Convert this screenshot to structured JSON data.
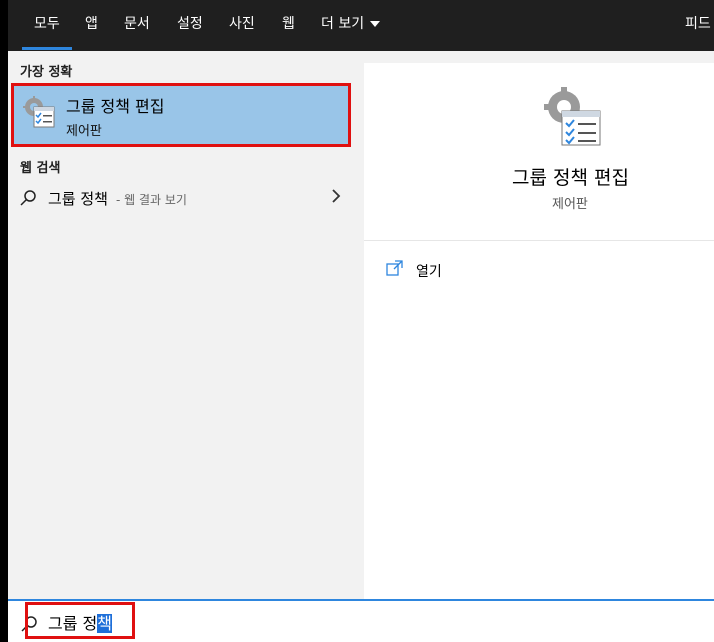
{
  "tabs": [
    {
      "label": "모두",
      "active": true
    },
    {
      "label": "앱"
    },
    {
      "label": "문서"
    },
    {
      "label": "설정"
    },
    {
      "label": "사진"
    },
    {
      "label": "웹"
    },
    {
      "label": "더 보기"
    },
    {
      "label": "피드"
    }
  ],
  "left": {
    "best_match_heading": "가장 정확",
    "best_match": {
      "title": "그룹 정책 편집",
      "subtitle": "제어판",
      "icon": "group-policy-icon"
    },
    "web_heading": "웹 검색",
    "web_result": {
      "query": "그룹 정책",
      "hint": "- 웹 결과 보기"
    }
  },
  "right": {
    "app_title": "그룹 정책 편집",
    "app_subtitle": "제어판",
    "action_open": "열기"
  },
  "search": {
    "typed_prefix": "그룹 정",
    "typed_selected": "책"
  },
  "colors": {
    "accent": "#2e86de",
    "highlight_box": "#e01010",
    "selected_item_bg": "#99c5e8",
    "tabbar_bg": "#1f1f1f"
  }
}
